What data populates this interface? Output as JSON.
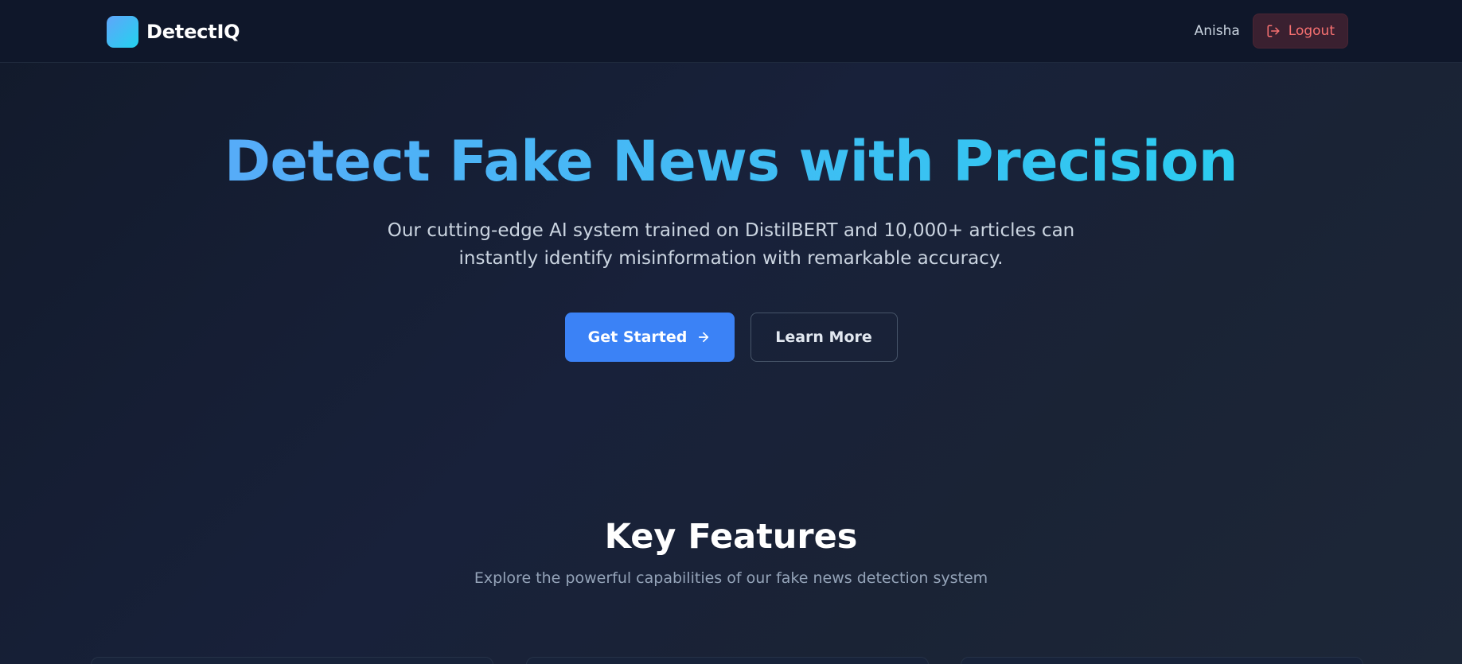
{
  "nav": {
    "brand": "DetectIQ",
    "username": "Anisha",
    "logout_label": "Logout"
  },
  "hero": {
    "title": "Detect Fake News with Precision",
    "subtitle": "Our cutting-edge AI system trained on DistilBERT and 10,000+ articles can instantly identify misinformation with remarkable accuracy.",
    "primary_cta": "Get Started",
    "secondary_cta": "Learn More"
  },
  "features": {
    "title": "Key Features",
    "subtitle": "Explore the powerful capabilities of our fake news detection system"
  },
  "icons": {
    "logo": "brand-logo-icon",
    "logout": "logout-icon",
    "cta_arrow": "arrow-right-icon"
  },
  "colors": {
    "accent_blue": "#3b82f6",
    "gradient_start": "#60a5fa",
    "gradient_end": "#22d3ee",
    "danger": "#f87171"
  }
}
